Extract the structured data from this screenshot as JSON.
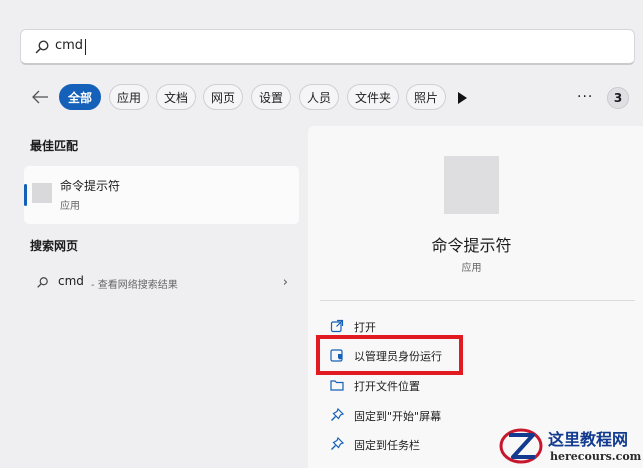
{
  "search": {
    "query": "cmd"
  },
  "filters": {
    "chips": [
      "全部",
      "应用",
      "文档",
      "网页",
      "设置",
      "人员",
      "文件夹",
      "照片"
    ],
    "more": "···",
    "count": "3"
  },
  "best_match": {
    "title": "最佳匹配",
    "name": "命令提示符",
    "type": "应用"
  },
  "web": {
    "title": "搜索网页",
    "query": "cmd",
    "suffix": "- 查看网络搜索结果"
  },
  "detail": {
    "name": "命令提示符",
    "type": "应用",
    "actions": [
      "打开",
      "以管理员身份运行",
      "打开文件位置",
      "固定到\"开始\"屏幕",
      "固定到任务栏"
    ]
  },
  "watermark": {
    "name": "这里教程网",
    "url": "herecours.com"
  },
  "colors": {
    "accent": "#1560b8",
    "highlight": "#e21a22"
  }
}
